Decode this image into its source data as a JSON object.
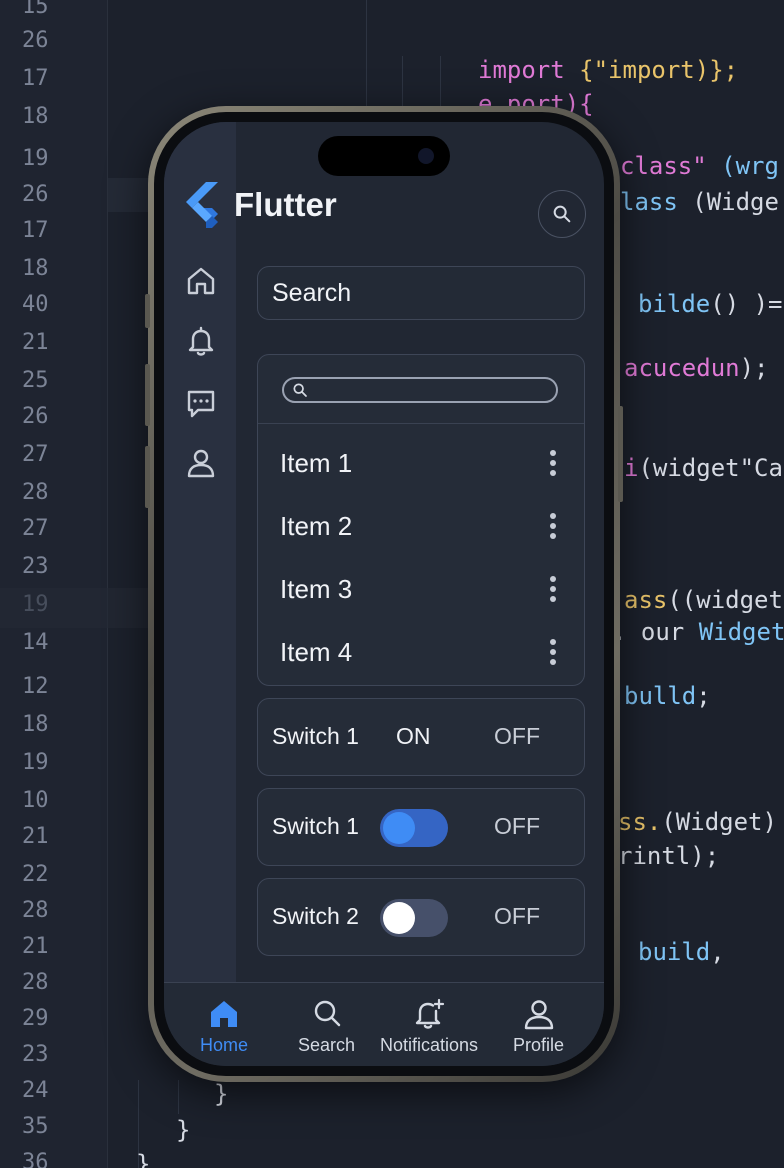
{
  "editor": {
    "line_numbers": [
      "15",
      "26",
      "17",
      "18",
      "19",
      "26",
      "17",
      "18",
      "40",
      "21",
      "25",
      "26",
      "27",
      "28",
      "27",
      "23",
      "19",
      "14",
      "12",
      "18",
      "19",
      "10",
      "21",
      "22",
      "28",
      "21",
      "28",
      "29",
      "23",
      "24",
      "35",
      "36"
    ],
    "code": {
      "l1_kw": "import",
      "l1_rest": " {\"import)};",
      "l2": "e port){",
      "l3_kw": "class\"",
      "l3_rest": " (wrg",
      "l4_kw": "lass",
      "l4_rest": " (Widge",
      "l5_fn": "bilde",
      "l5_rest": "() )=",
      "l6_kw": "acucedun",
      "l6_rest": ");",
      "l7_kw": "i",
      "l7_rest": "(widget\"Ca",
      "l8_kw": "ass",
      "l8_rest": "((widget",
      "l9_rest": ". our ",
      "l9_ty": "Widget",
      "l10_fn": "bulld",
      "l10_rest": ";",
      "l11_kw": "ss.",
      "l11_rest": "(Widget)",
      "l12": "rintl);",
      "l13_fn": "build",
      "l13_rest": ",",
      "brace1": "}",
      "brace2": "}",
      "brace3": "}"
    }
  },
  "app": {
    "brand": "Flutter",
    "search_placeholder": "Search",
    "list_items": [
      "Item 1",
      "Item 2",
      "Item 3",
      "Item 4"
    ],
    "switches": [
      {
        "label": "Switch 1",
        "on_text": "ON",
        "off_text": "OFF"
      },
      {
        "label": "Switch 1",
        "off_text": "OFF",
        "state": "on"
      },
      {
        "label": "Switch 2",
        "off_text": "OFF",
        "state": "off"
      }
    ],
    "bottom_nav": [
      {
        "label": "Home",
        "icon": "home-icon",
        "active": true
      },
      {
        "label": "Search",
        "icon": "search-icon"
      },
      {
        "label": "Notifications",
        "icon": "bell-plus-icon"
      },
      {
        "label": "Profile",
        "icon": "person-icon"
      }
    ],
    "rail_icons": [
      "home-icon",
      "bell-icon",
      "chat-icon",
      "person-icon"
    ]
  },
  "colors": {
    "accent": "#3f8cf5",
    "background": "#1c212c",
    "screen": "#212733"
  }
}
